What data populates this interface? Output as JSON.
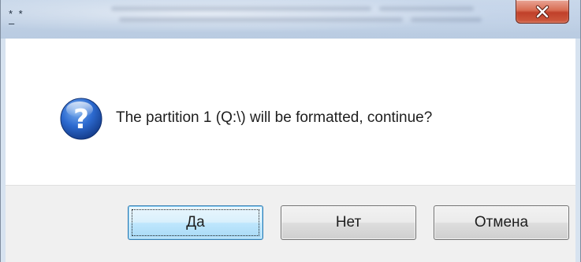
{
  "window": {
    "title": "* *\n–"
  },
  "dialog": {
    "message": "The partition 1 (Q:\\) will be formatted, continue?",
    "icon": "question-icon"
  },
  "buttons": {
    "yes_label": "Да",
    "no_label": "Нет",
    "cancel_label": "Отмена"
  },
  "colors": {
    "close_button": "#c0402a",
    "default_button_border": "#3c7fb1",
    "icon_blue": "#1f5fb5"
  }
}
